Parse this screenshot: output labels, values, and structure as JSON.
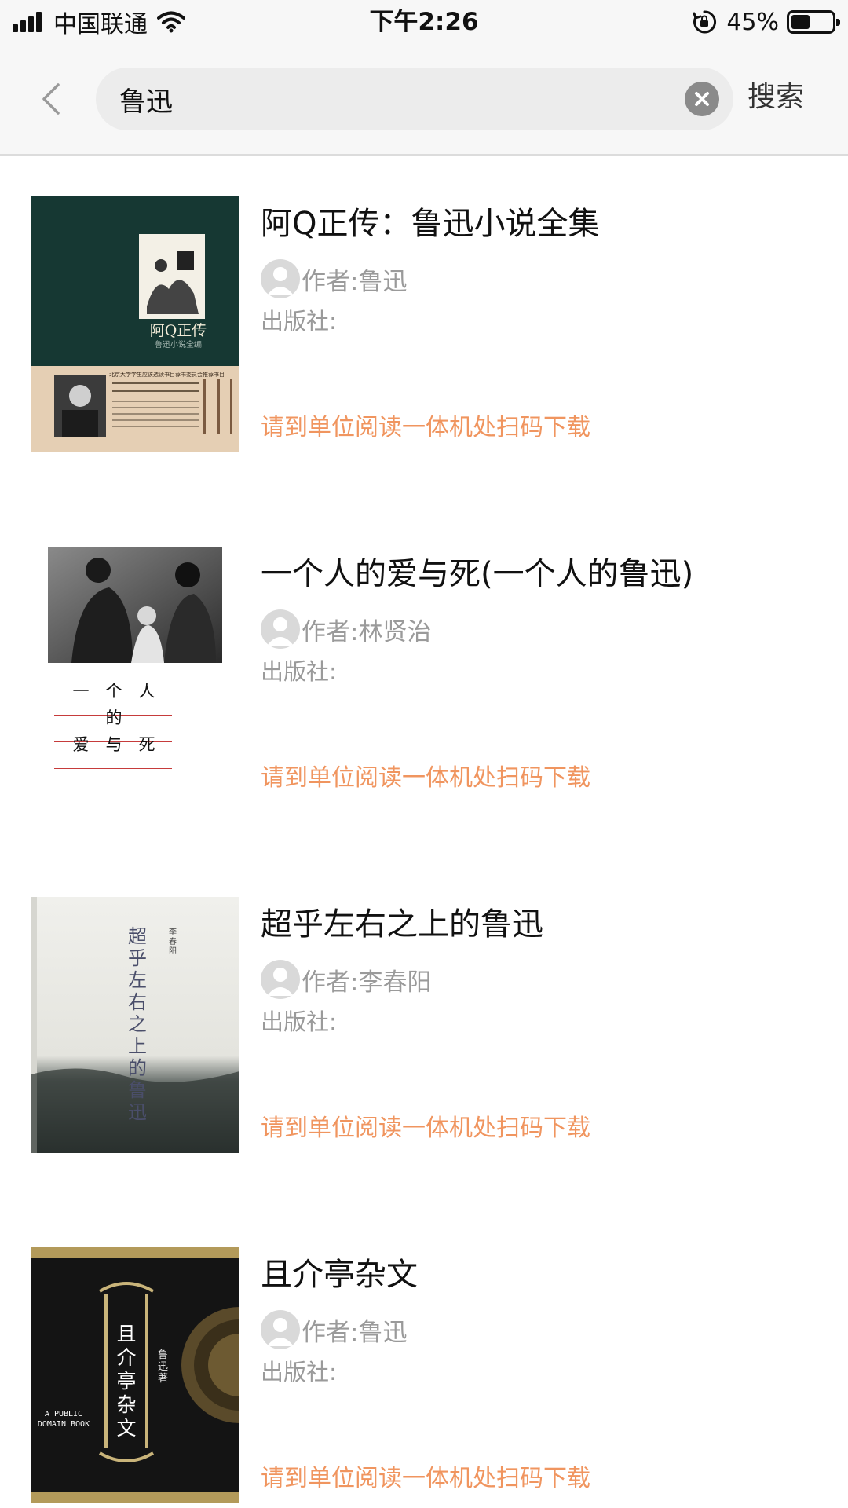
{
  "status_bar": {
    "carrier": "中国联通",
    "time": "下午2:26",
    "battery": "45%",
    "battery_level": 0.45
  },
  "search": {
    "query": "鲁迅",
    "submit_label": "搜索",
    "back_icon": "chevron-left-icon",
    "clear_icon": "clear-circle-icon"
  },
  "colors": {
    "notice": "#f0955f",
    "secondary_text": "#9a9a9a"
  },
  "books": [
    {
      "title": "阿Q正传：鲁迅小说全集",
      "author": "作者:鲁迅",
      "publisher": "出版社:",
      "notice": "请到单位阅读一体机处扫码下载",
      "cover": {
        "title": "阿Q正传",
        "subtitle": "鲁迅小说全编",
        "recommend": "北京大学学生应该选读书目荐书委员会推荐书目"
      }
    },
    {
      "title": "一个人的爱与死(一个人的鲁迅)",
      "author": "作者:林贤治",
      "publisher": "出版社:",
      "notice": "请到单位阅读一体机处扫码下载",
      "cover": {
        "line1": "一　个　人",
        "line2": "的",
        "line3": "爱　与　死"
      }
    },
    {
      "title": "超乎左右之上的鲁迅",
      "author": "作者:李春阳",
      "publisher": "出版社:",
      "notice": "请到单位阅读一体机处扫码下载",
      "cover": {
        "title": "超乎左右之上的鲁迅",
        "author": "李春阳"
      }
    },
    {
      "title": "且介亭杂文",
      "author": "作者:鲁迅",
      "publisher": "出版社:",
      "notice": "请到单位阅读一体机处扫码下载",
      "cover": {
        "title": "且介亭杂文",
        "author": "鲁迅著",
        "tag": "A PUBLIC DOMAIN BOOK"
      }
    }
  ]
}
